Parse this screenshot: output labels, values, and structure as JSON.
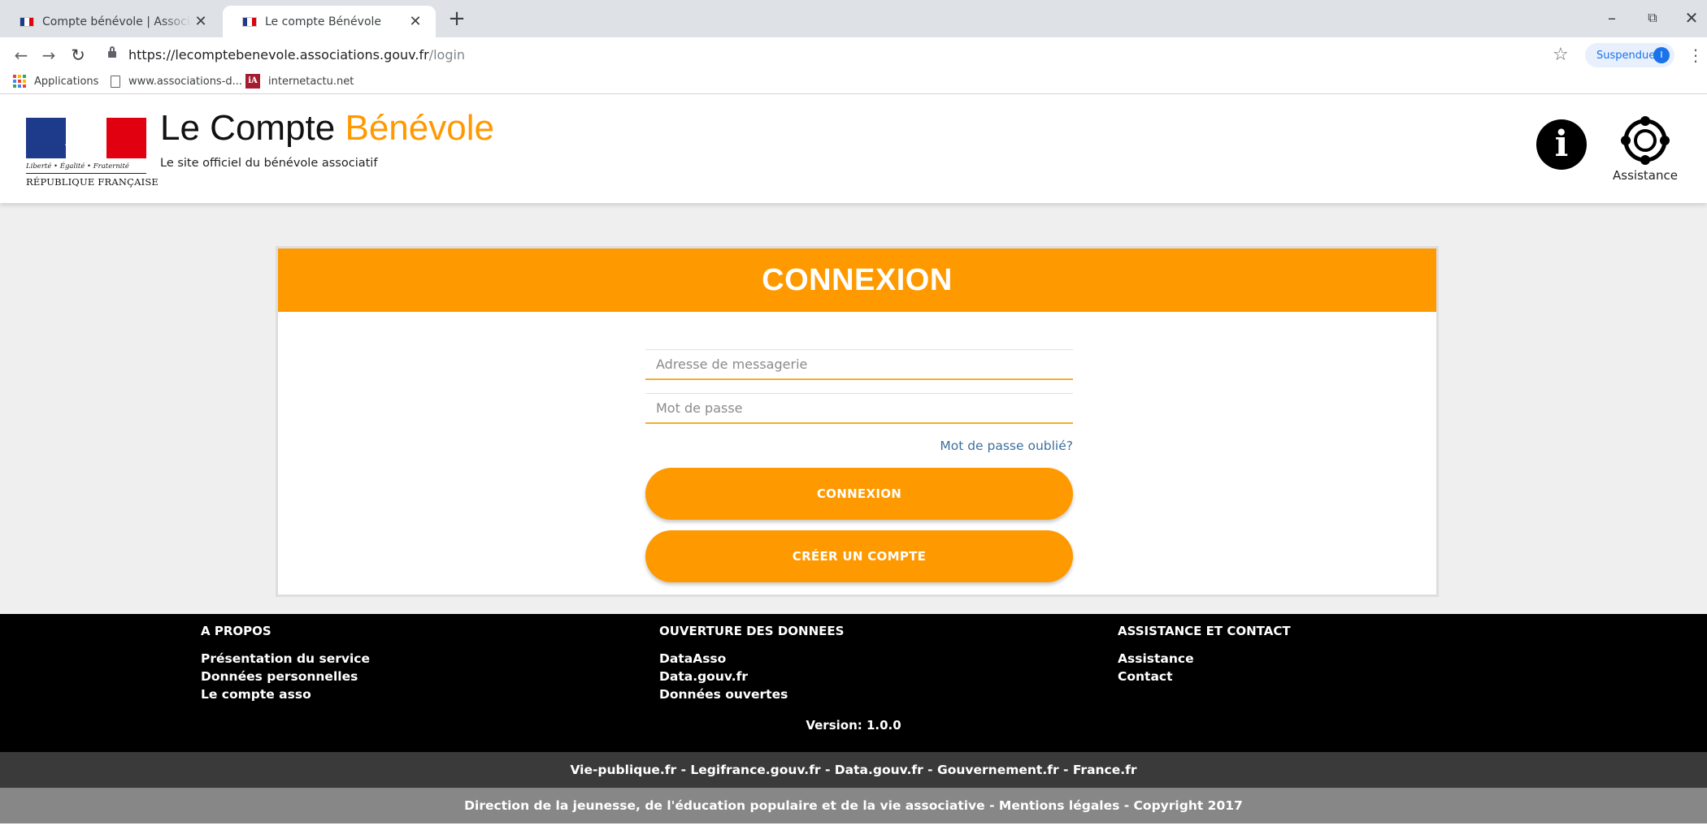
{
  "browser": {
    "tabs": [
      {
        "title": "Compte bénévole | Associations.gouv.fr",
        "active": false
      },
      {
        "title": "Le compte Bénévole",
        "active": true
      }
    ],
    "close_glyph": "✕",
    "new_tab_glyph": "+",
    "window_controls": {
      "minimize": "–",
      "maximize": "⧉",
      "close": "✕"
    },
    "url_host": "https://lecomptebenevole.associations.gouv.fr",
    "url_path": "/login",
    "profile_label": "Suspendue",
    "profile_initial": "I",
    "bookmarks": [
      {
        "label": "Applications",
        "icon": "apps-grid-icon"
      },
      {
        "label": "www.associations-d...",
        "icon": "page-icon"
      },
      {
        "label": "internetactu.net",
        "icon": "ia-icon",
        "icon_text": "iA"
      }
    ]
  },
  "header": {
    "logo": {
      "motto": "Liberté • Égalité • Fraternité",
      "republic": "RÉPUBLIQUE FRANÇAISE"
    },
    "title_main": "Le Compte ",
    "title_accent": "Bénévole",
    "subtitle": "Le site officiel du bénévole associatif",
    "info_icon": "i",
    "assistance_label": "Assistance"
  },
  "login": {
    "heading": "CONNEXION",
    "email_placeholder": "Adresse de messagerie",
    "email_value": "",
    "password_placeholder": "Mot de passe",
    "password_value": "",
    "forgot_label": "Mot de passe oublié?",
    "login_button": "CONNEXION",
    "create_button": "CRÉER UN COMPTE"
  },
  "footer": {
    "columns": [
      {
        "heading": "A PROPOS",
        "links": [
          "Présentation du service",
          "Données personnelles",
          "Le compte asso"
        ]
      },
      {
        "heading": "OUVERTURE DES DONNEES",
        "links": [
          "DataAsso",
          "Data.gouv.fr",
          "Données ouvertes"
        ]
      },
      {
        "heading": "ASSISTANCE ET CONTACT",
        "links": [
          "Assistance",
          "Contact"
        ]
      }
    ],
    "version": "Version: 1.0.0",
    "links_bar": "Vie-publique.fr - Legifrance.gouv.fr - Data.gouv.fr - Gouvernement.fr - France.fr",
    "legal_bar": "Direction de la jeunesse, de l'éducation populaire et de la vie associative - Mentions légales - Copyright 2017"
  },
  "colors": {
    "accent": "#ff9900",
    "link": "#3d6f9d",
    "footer_bg": "#000000",
    "links_bar_bg": "#3a3a3a",
    "legal_bar_bg": "#878787",
    "page_bg": "#efefef"
  }
}
